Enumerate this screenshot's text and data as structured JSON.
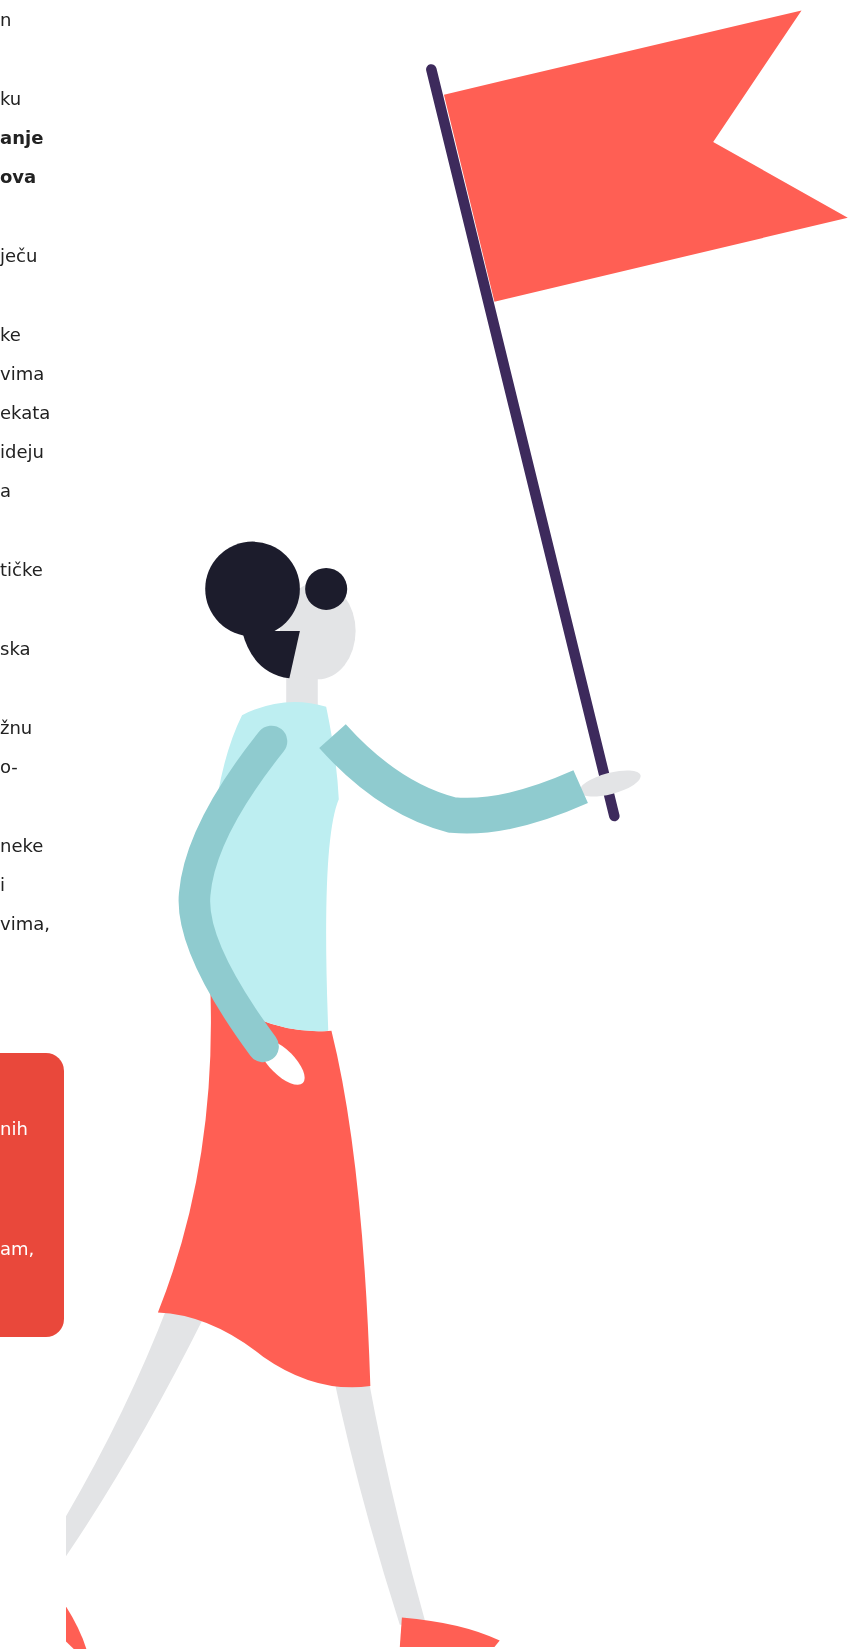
{
  "article": {
    "paragraphs": [
      {
        "lines": [
          {
            "text": "n",
            "bold": false
          }
        ]
      },
      {
        "lines": [
          {
            "text": "ku",
            "bold": false
          },
          {
            "text": "anje",
            "bold": true
          },
          {
            "text": "ova",
            "bold": true
          }
        ]
      },
      {
        "lines": [
          {
            "text": "ječu",
            "bold": false
          }
        ]
      },
      {
        "lines": [
          {
            "text": "ke",
            "bold": false
          },
          {
            "text": "vima",
            "bold": false
          },
          {
            "text": "ekata",
            "bold": false
          },
          {
            "text": "ideju",
            "bold": false
          },
          {
            "text": "a",
            "bold": false
          }
        ]
      },
      {
        "lines": [
          {
            "text": "tičke",
            "bold": false
          }
        ]
      },
      {
        "lines": [
          {
            "text": "ska",
            "bold": false
          }
        ]
      },
      {
        "lines": [
          {
            "text": "žnu",
            "bold": false
          },
          {
            "text": "o-",
            "bold": false
          }
        ]
      },
      {
        "lines": [
          {
            "text": "neke",
            "bold": false
          },
          {
            "text": "i",
            "bold": false
          },
          {
            "text": "vima,",
            "bold": false
          }
        ]
      }
    ]
  },
  "callout": {
    "lines": [
      "nih",
      "am,"
    ]
  }
}
